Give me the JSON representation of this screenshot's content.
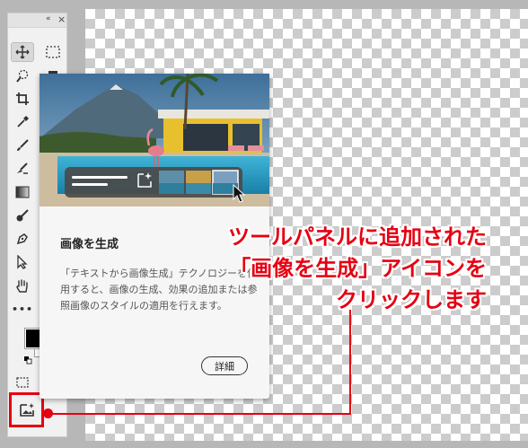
{
  "tooltip": {
    "title": "画像を生成",
    "description": "「テキストから画像生成」テクノロジーを使用すると、画像の生成、効果の追加または参照画像のスタイルの適用を行えます。",
    "detail_button": "詳細"
  },
  "annotation": {
    "line1": "ツールパネルに追加された",
    "line2": "「画像を生成」アイコンを",
    "line3": "クリックします"
  },
  "toolbar": {
    "collapse_glyph": "«",
    "close_glyph": "×",
    "icons": [
      "move-icon",
      "marquee-icon",
      "quick-select-icon",
      "lasso-icon",
      "crop-icon",
      "eyedropper-icon",
      "brush-icon",
      "clone-stamp-icon",
      "gradient-icon",
      "dodge-icon",
      "pen-icon",
      "path-select-icon",
      "hand-icon",
      "more-icon",
      "generate-image-icon"
    ],
    "more_glyph": "•••"
  },
  "colors": {
    "accent_red": "#e60012",
    "foreground": "#000000",
    "background": "#ffffff"
  }
}
